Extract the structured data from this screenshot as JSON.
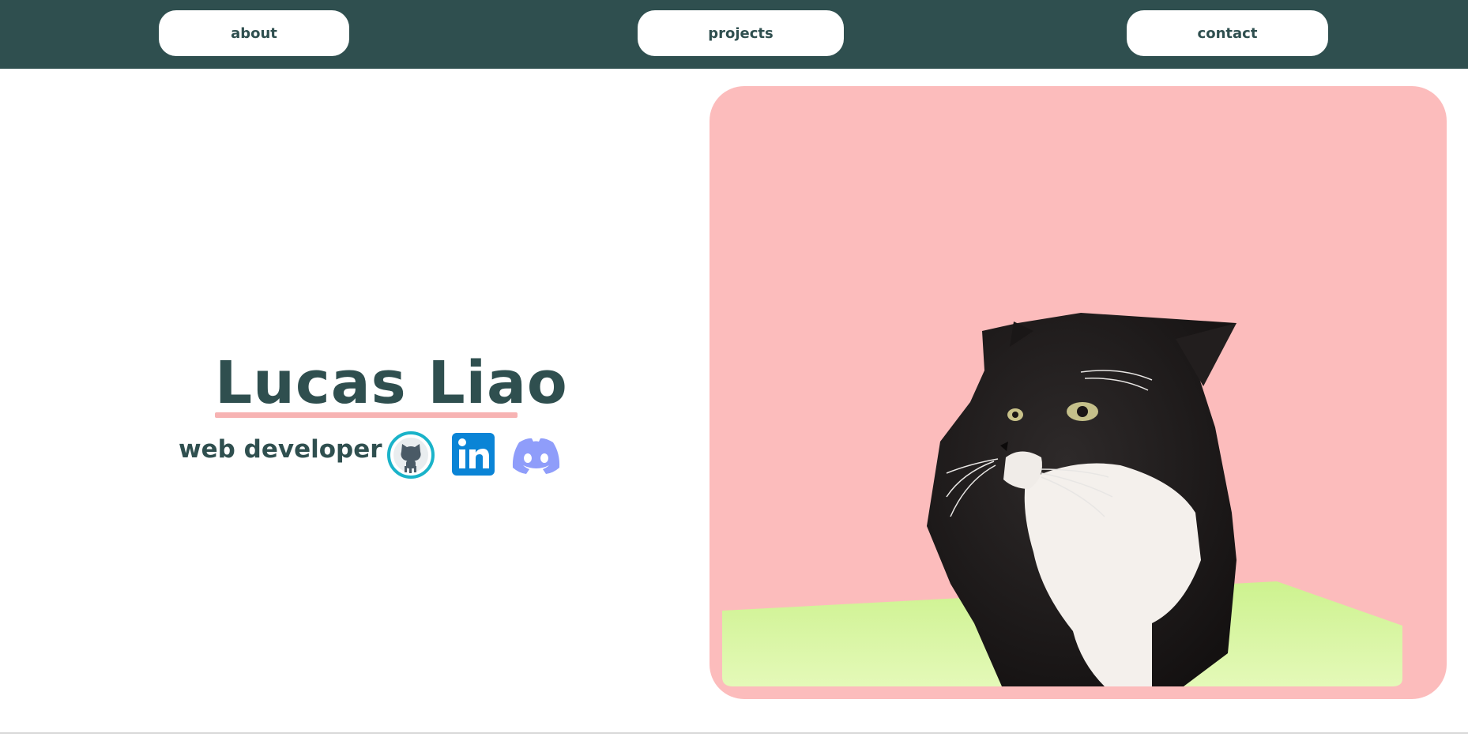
{
  "nav": {
    "about_label": "about",
    "projects_label": "projects",
    "contact_label": "contact"
  },
  "hero": {
    "name": "Lucas Liao",
    "role": "web developer"
  },
  "social": [
    {
      "name": "github",
      "icon": "github-icon"
    },
    {
      "name": "linkedin",
      "icon": "linkedin-icon"
    },
    {
      "name": "discord",
      "icon": "discord-icon"
    }
  ],
  "scene": {
    "subject": "cat-3d-model"
  },
  "colors": {
    "nav_bg": "#2f4f4f",
    "text": "#2f4f4f",
    "accent_pink": "#fcbcbc",
    "ground_green": "#d4f5a0",
    "github_ring": "#1ab3c9",
    "linkedin_blue": "#0a84d6",
    "discord_purple": "#8f9dfa"
  }
}
